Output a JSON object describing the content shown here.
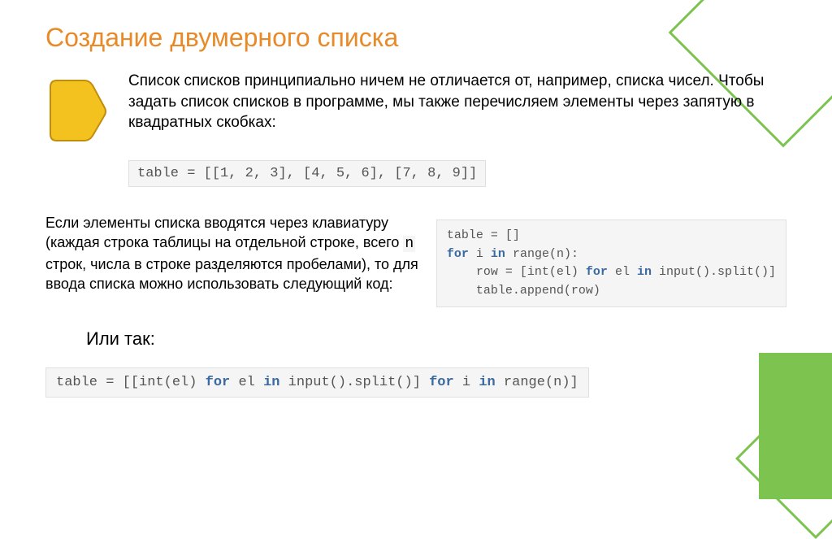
{
  "title": "Создание двумерного списка",
  "intro": "Список списков принципиально ничем не отличается от, например, списка чисел. Чтобы задать список списков в программе, мы также перечисляем элементы через запятую в квадратных скобках:",
  "code1": {
    "var": "table = ",
    "val": "[[1, 2, 3], [4, 5, 6], [7, 8, 9]]"
  },
  "mid_p1": "Если элементы списка вводятся через клавиатуру (каждая строка таблицы на отдельной строке, всего ",
  "mid_mono": "n",
  "mid_p2": " строк, числа в строке разделяются пробелами), то для ввода списка можно использовать следующий код:",
  "code2": {
    "l1a": "table = []",
    "l2a": "for",
    "l2b": " i ",
    "l2c": "in",
    "l2d": " range(n):",
    "l3a": "    row = [int(el) ",
    "l3b": "for",
    "l3c": " el ",
    "l3d": "in",
    "l3e": " input().split()]",
    "l4a": "    table.append(row)"
  },
  "or": "Или так:",
  "code3": {
    "a": "table = [[int(el) ",
    "b": "for",
    "c": " el ",
    "d": "in",
    "e": " input().split()] ",
    "f": "for",
    "g": " i ",
    "h": "in",
    "i": " range(n)]"
  },
  "icon": {
    "fill": "#f4c21f",
    "stroke": "#c28d0d"
  }
}
